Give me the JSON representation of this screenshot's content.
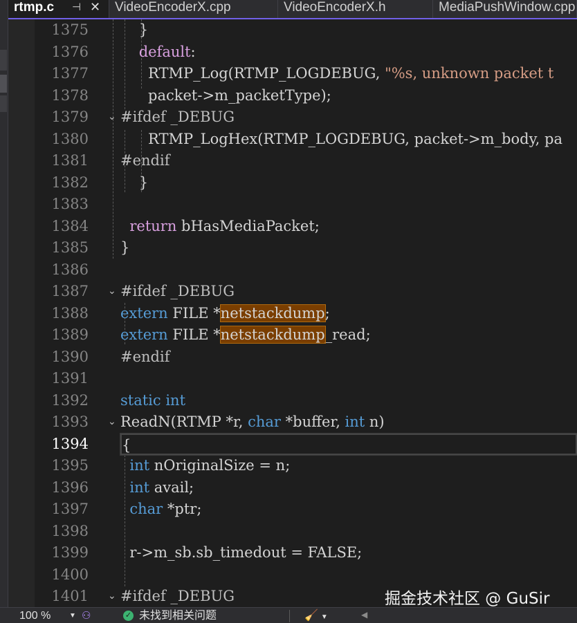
{
  "tabs": [
    {
      "label": "rtmp.c",
      "active": true,
      "pin_icon": "pin-icon",
      "close_icon": "close-icon"
    },
    {
      "label": "VideoEncoderX.cpp",
      "active": false
    },
    {
      "label": "VideoEncoderX.h",
      "active": false
    },
    {
      "label": "MediaPushWindow.cpp",
      "active": false
    }
  ],
  "editor": {
    "current_line": 1394,
    "lines": [
      {
        "n": "1375",
        "fold": "",
        "tokens": [
          {
            "t": "    }",
            "c": "plain"
          }
        ]
      },
      {
        "n": "1376",
        "fold": "",
        "tokens": [
          {
            "t": "    ",
            "c": "plain"
          },
          {
            "t": "default",
            "c": "control"
          },
          {
            "t": ":",
            "c": "plain"
          }
        ]
      },
      {
        "n": "1377",
        "fold": "",
        "tokens": [
          {
            "t": "      RTMP_Log(RTMP_LOGDEBUG, ",
            "c": "plain"
          },
          {
            "t": "\"%s, unknown packet t",
            "c": "string"
          }
        ]
      },
      {
        "n": "1378",
        "fold": "",
        "tokens": [
          {
            "t": "      packet->m_packetType);",
            "c": "plain"
          }
        ]
      },
      {
        "n": "1379",
        "fold": "v",
        "tokens": [
          {
            "t": "#ifdef _DEBUG",
            "c": "macro"
          }
        ]
      },
      {
        "n": "1380",
        "fold": "",
        "tokens": [
          {
            "t": "      RTMP_LogHex(RTMP_LOGDEBUG, packet->m_body, pa",
            "c": "plain"
          }
        ]
      },
      {
        "n": "1381",
        "fold": "",
        "tokens": [
          {
            "t": "#endif",
            "c": "macro"
          }
        ]
      },
      {
        "n": "1382",
        "fold": "",
        "tokens": [
          {
            "t": "    }",
            "c": "plain"
          }
        ]
      },
      {
        "n": "1383",
        "fold": "",
        "tokens": [
          {
            "t": "",
            "c": "plain"
          }
        ]
      },
      {
        "n": "1384",
        "fold": "",
        "tokens": [
          {
            "t": "  ",
            "c": "plain"
          },
          {
            "t": "return",
            "c": "control"
          },
          {
            "t": " bHasMediaPacket;",
            "c": "plain"
          }
        ]
      },
      {
        "n": "1385",
        "fold": "",
        "tokens": [
          {
            "t": "}",
            "c": "plain"
          }
        ]
      },
      {
        "n": "1386",
        "fold": "",
        "tokens": [
          {
            "t": "",
            "c": "plain"
          }
        ]
      },
      {
        "n": "1387",
        "fold": "v",
        "tokens": [
          {
            "t": "#ifdef _DEBUG",
            "c": "macro"
          }
        ]
      },
      {
        "n": "1388",
        "fold": "",
        "tokens": [
          {
            "t": "extern",
            "c": "keyword"
          },
          {
            "t": " FILE *",
            "c": "plain"
          },
          {
            "t": "netstackdump",
            "c": "highlight"
          },
          {
            "t": ";",
            "c": "plain"
          }
        ]
      },
      {
        "n": "1389",
        "fold": "",
        "tokens": [
          {
            "t": "extern",
            "c": "keyword"
          },
          {
            "t": " FILE *",
            "c": "plain"
          },
          {
            "t": "netstackdump",
            "c": "highlight"
          },
          {
            "t": "_read;",
            "c": "plain"
          }
        ]
      },
      {
        "n": "1390",
        "fold": "",
        "tokens": [
          {
            "t": "#endif",
            "c": "macro"
          }
        ]
      },
      {
        "n": "1391",
        "fold": "",
        "tokens": [
          {
            "t": "",
            "c": "plain"
          }
        ]
      },
      {
        "n": "1392",
        "fold": "",
        "tokens": [
          {
            "t": "static",
            "c": "keyword"
          },
          {
            "t": " ",
            "c": "plain"
          },
          {
            "t": "int",
            "c": "keyword"
          }
        ]
      },
      {
        "n": "1393",
        "fold": "v",
        "tokens": [
          {
            "t": "ReadN(RTMP *r, ",
            "c": "plain"
          },
          {
            "t": "char",
            "c": "keyword"
          },
          {
            "t": " *buffer, ",
            "c": "plain"
          },
          {
            "t": "int",
            "c": "keyword"
          },
          {
            "t": " n)",
            "c": "plain"
          }
        ]
      },
      {
        "n": "1394",
        "fold": "",
        "tokens": [
          {
            "t": "{",
            "c": "plain"
          }
        ]
      },
      {
        "n": "1395",
        "fold": "",
        "tokens": [
          {
            "t": "  ",
            "c": "plain"
          },
          {
            "t": "int",
            "c": "keyword"
          },
          {
            "t": " nOriginalSize = n;",
            "c": "plain"
          }
        ]
      },
      {
        "n": "1396",
        "fold": "",
        "tokens": [
          {
            "t": "  ",
            "c": "plain"
          },
          {
            "t": "int",
            "c": "keyword"
          },
          {
            "t": " avail;",
            "c": "plain"
          }
        ]
      },
      {
        "n": "1397",
        "fold": "",
        "tokens": [
          {
            "t": "  ",
            "c": "plain"
          },
          {
            "t": "char",
            "c": "keyword"
          },
          {
            "t": " *ptr;",
            "c": "plain"
          }
        ]
      },
      {
        "n": "1398",
        "fold": "",
        "tokens": [
          {
            "t": "",
            "c": "plain"
          }
        ]
      },
      {
        "n": "1399",
        "fold": "",
        "tokens": [
          {
            "t": "  r->m_sb.sb_timedout = FALSE;",
            "c": "plain"
          }
        ]
      },
      {
        "n": "1400",
        "fold": "",
        "tokens": [
          {
            "t": "",
            "c": "plain"
          }
        ]
      },
      {
        "n": "1401",
        "fold": "v",
        "tokens": [
          {
            "t": "#ifdef _DEBUG",
            "c": "macro"
          }
        ]
      }
    ]
  },
  "watermark": "掘金技术社区 @ GuSir",
  "status": {
    "zoom": "100 %",
    "issues_text": "未找到相关问题",
    "ok_icon": "check-circle-icon",
    "copilot_icon": "copilot-icon",
    "cleanup_icon": "broom-icon"
  },
  "colors": {
    "keyword": "#569cd6",
    "control": "#d8a0df",
    "string": "#d69d85",
    "highlight_bg": "#7a3e00",
    "tab_accent": "#7160e8",
    "ok_green": "#3cb371"
  }
}
